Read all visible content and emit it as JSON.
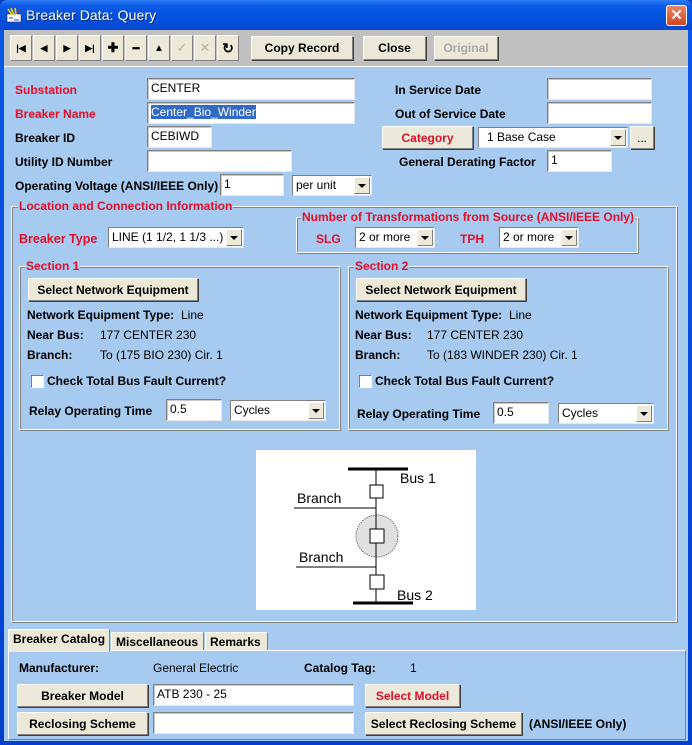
{
  "window": {
    "title": "Breaker Data: Query",
    "close_label": "✕"
  },
  "toolbar": {
    "nav_buttons": [
      {
        "name": "first-record",
        "glyph": "|◀",
        "enabled": true
      },
      {
        "name": "previous-record",
        "glyph": "◀",
        "enabled": true
      },
      {
        "name": "next-record",
        "glyph": "▶",
        "enabled": true
      },
      {
        "name": "last-record",
        "glyph": "▶|",
        "enabled": true
      },
      {
        "name": "add-record",
        "glyph": "✚",
        "enabled": true
      },
      {
        "name": "delete-record",
        "glyph": "━",
        "enabled": true
      },
      {
        "name": "edit-record",
        "glyph": "▲",
        "enabled": true
      },
      {
        "name": "accept-record",
        "glyph": "✓",
        "enabled": false
      },
      {
        "name": "cancel-record",
        "glyph": "✕",
        "enabled": false
      },
      {
        "name": "refresh-record",
        "glyph": "↻",
        "enabled": true
      }
    ],
    "copy_record": "Copy Record",
    "close": "Close",
    "original": "Original"
  },
  "form": {
    "substation": {
      "label": "Substation",
      "value": "CENTER"
    },
    "breaker_name": {
      "label": "Breaker Name",
      "value": "Center_Bio_Winder"
    },
    "breaker_id": {
      "label": "Breaker ID",
      "value": "CEBIWD"
    },
    "utility_id": {
      "label": "Utility ID Number",
      "value": ""
    },
    "operating_voltage": {
      "label": "Operating Voltage (ANSI/IEEE Only)",
      "value": "1",
      "unit": "per unit"
    },
    "in_service_date": {
      "label": "In Service Date",
      "value": ""
    },
    "out_of_service_date": {
      "label": "Out of Service Date",
      "value": ""
    },
    "category": {
      "button": "Category",
      "value": "1 Base Case",
      "more": "..."
    },
    "derating_factor": {
      "label": "General Derating Factor",
      "value": "1"
    }
  },
  "location": {
    "title": "Location and Connection Information",
    "breaker_type": {
      "label": "Breaker Type",
      "value": "LINE (1 1/2, 1 1/3 ...)"
    },
    "transformations": {
      "title": "Number of Transformations from Source (ANSI/IEEE Only)",
      "slg": {
        "label": "SLG",
        "value": "2 or more"
      },
      "tph": {
        "label": "TPH",
        "value": "2 or more"
      }
    },
    "sections": [
      {
        "title": "Section 1",
        "select_button": "Select Network Equipment",
        "equip_type_label": "Network Equipment Type:",
        "equip_type": "Line",
        "near_bus_label": "Near Bus:",
        "near_bus": "177 CENTER 230",
        "branch_label": "Branch:",
        "branch": "To (175 BIO 230) Cir. 1",
        "check_label": "Check Total Bus Fault Current?",
        "checked": false,
        "relay_label": "Relay Operating Time",
        "relay_value": "0.5",
        "relay_unit": "Cycles"
      },
      {
        "title": "Section 2",
        "select_button": "Select Network Equipment",
        "equip_type_label": "Network Equipment Type:",
        "equip_type": "Line",
        "near_bus_label": "Near Bus:",
        "near_bus": "177 CENTER 230",
        "branch_label": "Branch:",
        "branch": "To (183 WINDER 230) Cir. 1",
        "check_label": "Check Total Bus Fault Current?",
        "checked": false,
        "relay_label": "Relay Operating Time",
        "relay_value": "0.5",
        "relay_unit": "Cycles"
      }
    ],
    "diagram": {
      "bus1": "Bus 1",
      "bus2": "Bus 2",
      "branch1": "Branch",
      "branch2": "Branch"
    }
  },
  "tabs": [
    {
      "label": "Breaker Catalog",
      "active": true
    },
    {
      "label": "Miscellaneous",
      "active": false
    },
    {
      "label": "Remarks",
      "active": false
    }
  ],
  "catalog": {
    "manufacturer_label": "Manufacturer:",
    "manufacturer": "General Electric",
    "catalog_tag_label": "Catalog Tag:",
    "catalog_tag": "1",
    "breaker_model_button": "Breaker Model",
    "breaker_model_value": "ATB 230 - 25",
    "select_model_button": "Select Model",
    "reclosing_button": "Reclosing Scheme",
    "reclosing_value": "",
    "select_reclosing_button": "Select Reclosing Scheme",
    "ansi_note": "(ANSI/IEEE Only)"
  }
}
